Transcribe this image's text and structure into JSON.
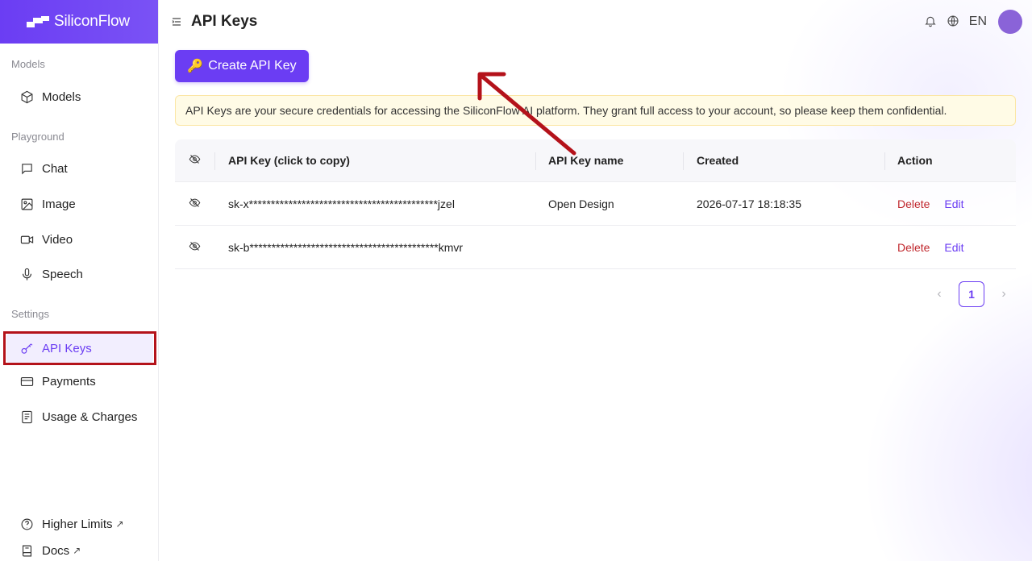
{
  "brand": {
    "name": "SiliconFlow"
  },
  "sidebar": {
    "sections": {
      "models": "Models",
      "playground": "Playground",
      "settings": "Settings"
    },
    "items": {
      "models": "Models",
      "chat": "Chat",
      "image": "Image",
      "video": "Video",
      "speech": "Speech",
      "api_keys": "API Keys",
      "payments": "Payments",
      "usage": "Usage & Charges",
      "higher_limits": "Higher Limits",
      "docs": "Docs"
    },
    "external_mark": "↗",
    "active_item": "API Keys"
  },
  "header": {
    "title": "API Keys",
    "language": "EN"
  },
  "toolbar": {
    "create_label": "Create API Key",
    "create_icon": "🔑"
  },
  "notice": {
    "text": "API Keys are your secure credentials for accessing the SiliconFlow AI platform. They grant full access to your account, so please keep them confidential."
  },
  "table": {
    "columns": {
      "key": "API Key (click to copy)",
      "name": "API Key name",
      "created": "Created",
      "action": "Action"
    },
    "rows": [
      {
        "key": "sk-x*******************************************jzel",
        "name": "Open Design",
        "created": "2026-07-17 18:18:35",
        "delete": "Delete",
        "edit": "Edit"
      },
      {
        "key": "sk-b*******************************************kmvr",
        "name": "",
        "created": "",
        "delete": "Delete",
        "edit": "Edit"
      }
    ]
  },
  "pagination": {
    "current_page": "1",
    "prev": "‹",
    "next": "›"
  },
  "colors": {
    "accent": "#6b3df3",
    "danger": "#c0272d",
    "highlight_box": "#b4121a",
    "notice_bg": "#fffbe6"
  }
}
